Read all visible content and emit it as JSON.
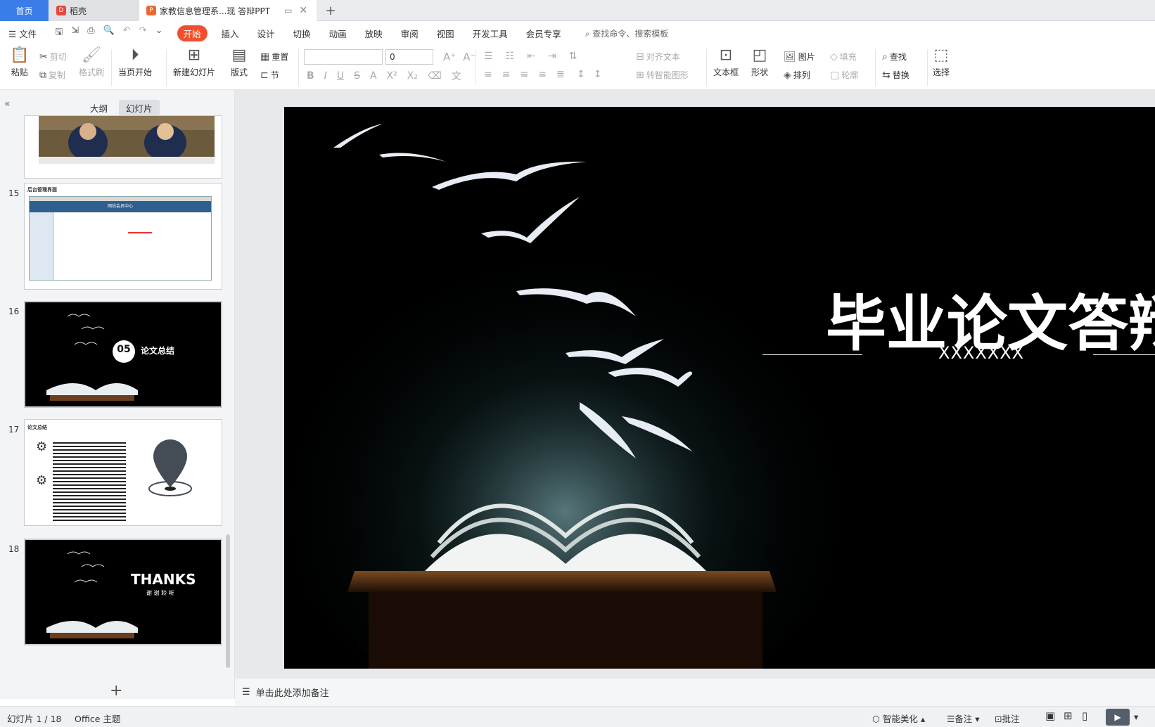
{
  "tabs": {
    "home": "首页",
    "docer": "稻壳",
    "document": "家教信息管理系...现 答辩PPT"
  },
  "menu": {
    "file": "文件",
    "items": [
      "开始",
      "插入",
      "设计",
      "切换",
      "动画",
      "放映",
      "审阅",
      "视图",
      "开发工具",
      "会员专享"
    ],
    "active": "开始",
    "search_placeholder": "查找命令、搜索模板"
  },
  "ribbon": {
    "paste": "粘贴",
    "cut": "剪切",
    "copy": "复制",
    "format_painter": "格式刷",
    "start_from_current": "当页开始",
    "new_slide": "新建幻灯片",
    "layout": "版式",
    "reset": "重置",
    "section": "节",
    "font_size": "0",
    "align_text": "对齐文本",
    "to_smartart": "转智能图形",
    "textbox": "文本框",
    "shape": "形状",
    "picture": "图片",
    "fill": "填充",
    "arrange": "排列",
    "outline": "轮廓",
    "find": "查找",
    "replace": "替换",
    "select": "选择"
  },
  "panel": {
    "outline_tab": "大纲",
    "slides_tab": "幻灯片",
    "thumbs": [
      {
        "num": "15",
        "title": "后台管理界面",
        "inner": "网站会员中心"
      },
      {
        "num": "16",
        "badge": "05",
        "title": "论文总结"
      },
      {
        "num": "17",
        "title": "论文总结"
      },
      {
        "num": "18",
        "title": "THANKS",
        "subtitle": "谢 谢 聆 听"
      }
    ]
  },
  "slide": {
    "title": "毕业论文答辩",
    "subtitle": "XXXXXXX"
  },
  "notes": {
    "placeholder": "单击此处添加备注"
  },
  "status": {
    "slide_count": "幻灯片 1 / 18",
    "theme": "Office 主题",
    "beautify": "智能美化",
    "notes": "备注",
    "comments": "批注"
  },
  "colors": {
    "accent": "#3b7de8",
    "active_tab": "#f04f2f",
    "slide_bg": "#000000"
  }
}
